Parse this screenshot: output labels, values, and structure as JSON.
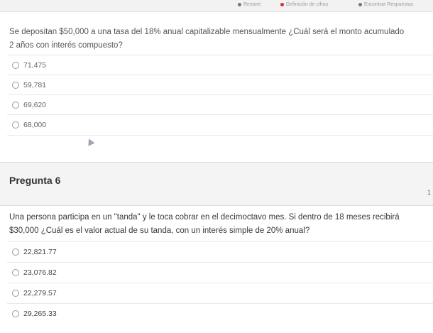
{
  "topbar": {
    "item1": "Restore",
    "item2": "Definición de cifras",
    "item3": "Encontrar Respuestas"
  },
  "question5": {
    "text_line1": "Se depositan $50,000 a una tasa del 18% anual capitalizable mensualmente ¿Cuál será el monto acumulado",
    "text_line2": "2 años con interés compuesto?",
    "options": [
      "71,475",
      "59,781",
      "69,620",
      "68,000"
    ]
  },
  "question6": {
    "title": "Pregunta 6",
    "points": "1",
    "text_line1": "Una persona participa en un \"tanda\" y le toca cobrar en el decimoctavo mes. Si dentro de 18 meses recibirá",
    "text_line2": "$30,000 ¿Cuál es el valor actual de su tanda, con un interés simple de 20% anual?",
    "options": [
      "22,821.77",
      "23,076.82",
      "22,279.57",
      "29,265.33"
    ]
  }
}
